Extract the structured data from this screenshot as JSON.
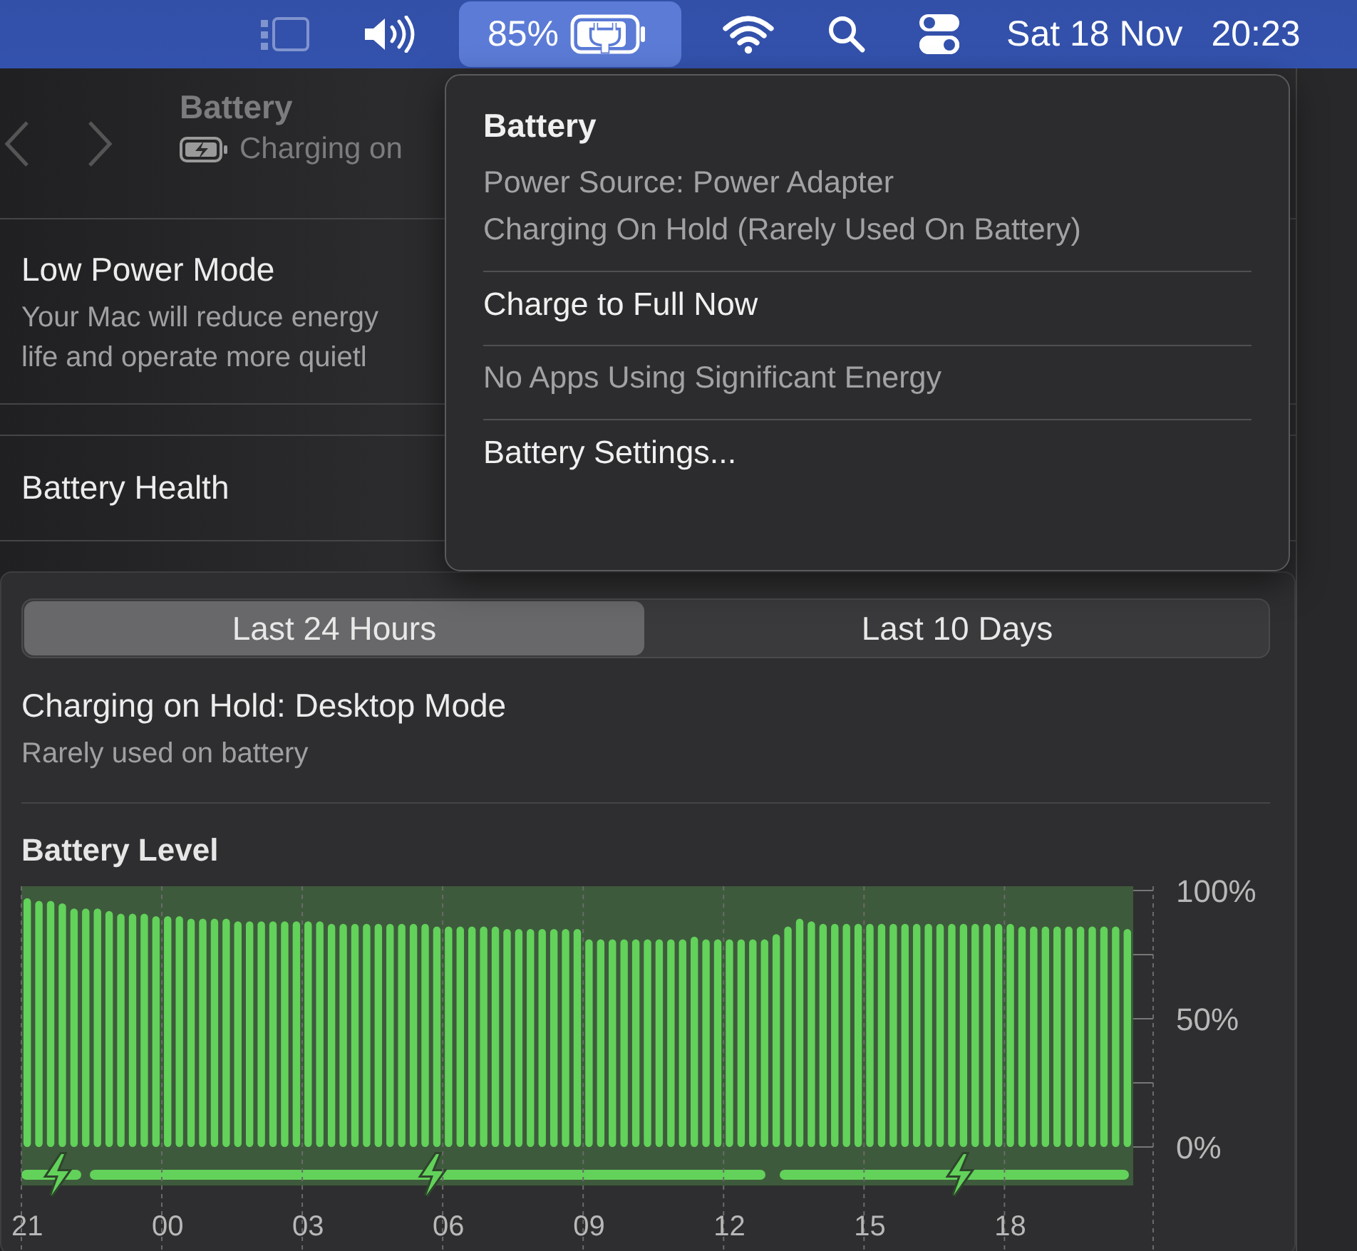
{
  "menu_bar": {
    "battery_item": {
      "label": "85%",
      "selected": true
    },
    "date": "Sat 18 Nov",
    "time": "20:23"
  },
  "settings": {
    "title": "Battery",
    "subtitle": "Charging on",
    "rows": [
      {
        "title": "Low Power Mode",
        "description": [
          "Your Mac will reduce energy",
          "life and operate more quietl"
        ]
      },
      {
        "title": "Battery Health"
      }
    ],
    "tabs": [
      {
        "label": "Last 24 Hours",
        "selected": true
      },
      {
        "label": "Last 10 Days",
        "selected": false
      }
    ],
    "status": {
      "title": "Charging on Hold: Desktop Mode",
      "subtitle": "Rarely used on battery"
    },
    "section_title": "Battery Level",
    "level_chart": {
      "y_labels": [
        "100%",
        "50%",
        "0%"
      ],
      "x_labels": [
        "21",
        "00",
        "03",
        "06",
        "09",
        "12",
        "15",
        "18"
      ]
    }
  },
  "popover": {
    "title": "Battery",
    "groups": [
      {
        "items": [
          {
            "label": "Power Source: Power Adapter",
            "disabled": true
          },
          {
            "label": "Charging On Hold (Rarely Used On Battery)",
            "disabled": true
          }
        ]
      },
      {
        "items": [
          {
            "label": "Charge to Full Now",
            "disabled": false
          }
        ]
      },
      {
        "items": [
          {
            "label": "No Apps Using Significant Energy",
            "disabled": true
          }
        ]
      },
      {
        "items": [
          {
            "label": "Battery Settings...",
            "disabled": false
          }
        ]
      }
    ]
  }
}
